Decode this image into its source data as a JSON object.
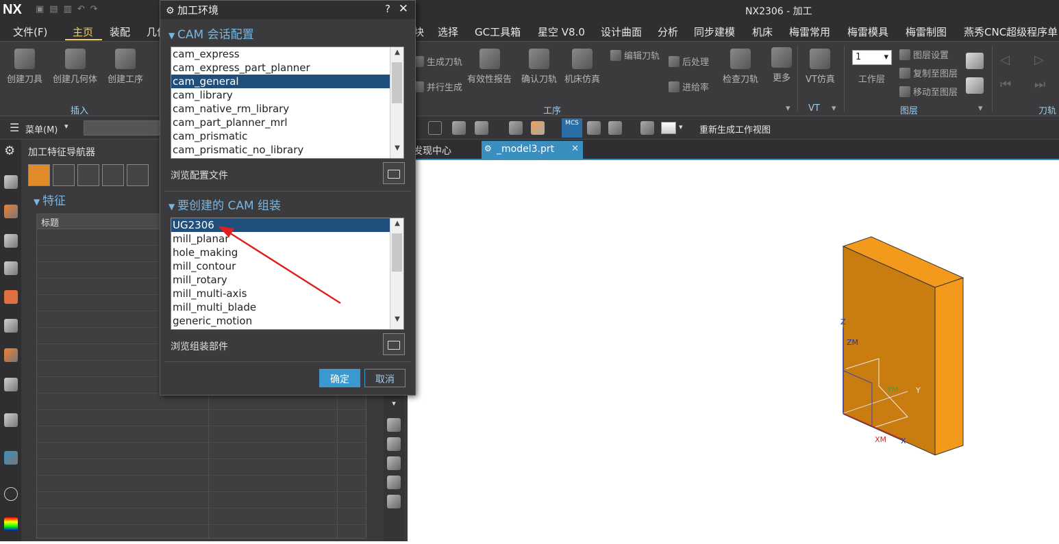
{
  "app": {
    "logo": "NX",
    "window_title": "NX2306 - 加工"
  },
  "menubar": [
    "文件(F)",
    "主页",
    "装配",
    "几何",
    "块",
    "选择",
    "GC工具箱",
    "星空 V8.0",
    "设计曲面",
    "分析",
    "同步建模",
    "机床",
    "梅雷常用",
    "梅雷模具",
    "梅雷制图",
    "燕秀CNC超级程序单"
  ],
  "ribbon": {
    "insert": [
      "创建刀具",
      "创建几何体",
      "创建工序"
    ],
    "insert_group": "插入",
    "ops_small": [
      "生成刀轨",
      "并行生成",
      "编辑刀轨",
      "后处理",
      "进给率"
    ],
    "ops": [
      "有效性报告",
      "确认刀轨",
      "机床仿真",
      "检查刀轨",
      "更多"
    ],
    "ops_group": "工序",
    "vt": "VT仿真",
    "vt_group": "VT",
    "layer_value": "1",
    "layer_label": "工作层",
    "layer_small": [
      "图层设置",
      "复制至图层",
      "移动至图层"
    ],
    "layer_group": "图层",
    "toolpath_group": "刀轨"
  },
  "toolbar": {
    "menu": "菜单(M)",
    "mcs": "MCS",
    "regen": "重新生成工作视图"
  },
  "nav": {
    "title": "加工特征导航器",
    "section": "特征",
    "col_title": "标题"
  },
  "tabs": {
    "discover": "发现中心",
    "model": "_model3.prt"
  },
  "viewport": {
    "axis_z": "Z",
    "axis_zm": "ZM",
    "axis_y": "Y",
    "axis_ym": "YM",
    "axis_xm": "XM",
    "axis_x": "X"
  },
  "dialog": {
    "title": "加工环境",
    "help": "?",
    "close": "✕",
    "session_title": "CAM 会话配置",
    "session_items": [
      "cam_express",
      "cam_express_part_planner",
      "cam_general",
      "cam_library",
      "cam_native_rm_library",
      "cam_part_planner_mrl",
      "cam_prismatic",
      "cam_prismatic_no_library"
    ],
    "session_selected": 2,
    "browse_config": "浏览配置文件",
    "assembly_title": "要创建的 CAM 组装",
    "assembly_items": [
      "UG2306",
      "mill_planar",
      "hole_making",
      "mill_contour",
      "mill_rotary",
      "mill_multi-axis",
      "mill_multi_blade",
      "generic_motion"
    ],
    "assembly_selected": 0,
    "browse_assembly": "浏览组装部件",
    "ok": "确定",
    "cancel": "取消"
  }
}
